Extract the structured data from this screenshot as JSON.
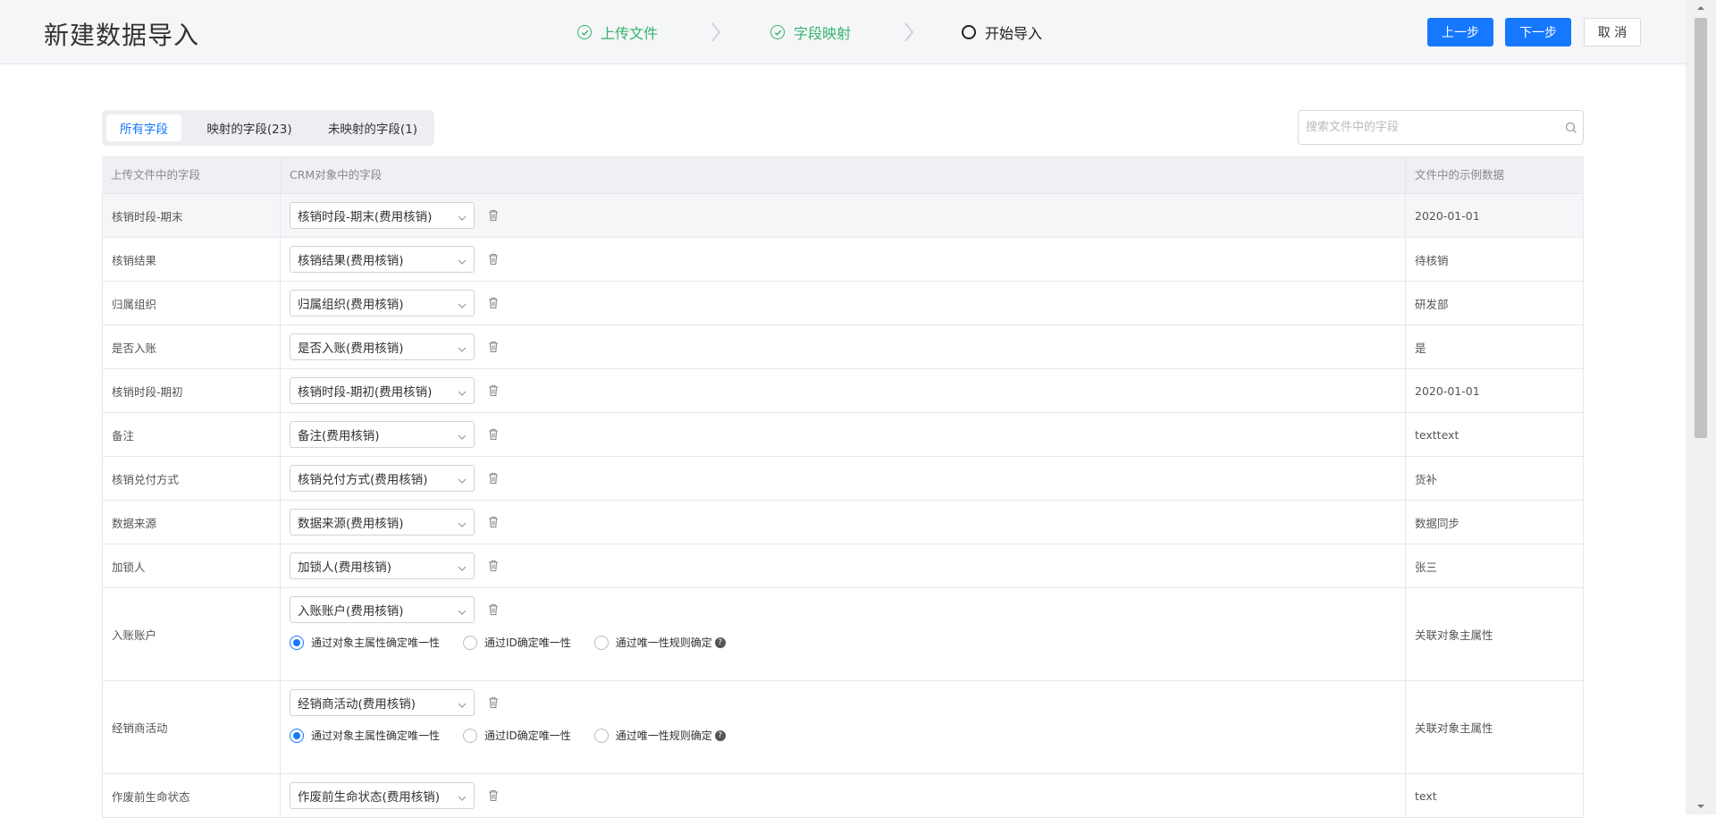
{
  "header": {
    "title": "新建数据导入",
    "steps": [
      {
        "label": "上传文件",
        "status": "done"
      },
      {
        "label": "字段映射",
        "status": "done"
      },
      {
        "label": "开始导入",
        "status": "current"
      }
    ],
    "prev_label": "上一步",
    "next_label": "下一步",
    "cancel_label": "取 消"
  },
  "tabs": [
    {
      "label": "所有字段",
      "active": true
    },
    {
      "label": "映射的字段(23)",
      "active": false
    },
    {
      "label": "未映射的字段(1)",
      "active": false
    }
  ],
  "search": {
    "placeholder": "搜索文件中的字段",
    "value": ""
  },
  "table": {
    "columns": [
      "上传文件中的字段",
      "CRM对象中的字段",
      "文件中的示例数据"
    ],
    "radio_options": [
      "通过对象主属性确定唯一性",
      "通过ID确定唯一性",
      "通过唯一性规则确定"
    ],
    "rows": [
      {
        "file_field": "核销时段-期末",
        "crm_field": "核销时段-期末(费用核销)",
        "sample": "2020-01-01"
      },
      {
        "file_field": "核销结果",
        "crm_field": "核销结果(费用核销)",
        "sample": "待核销"
      },
      {
        "file_field": "归属组织",
        "crm_field": "归属组织(费用核销)",
        "sample": "研发部"
      },
      {
        "file_field": "是否入账",
        "crm_field": "是否入账(费用核销)",
        "sample": "是"
      },
      {
        "file_field": "核销时段-期初",
        "crm_field": "核销时段-期初(费用核销)",
        "sample": "2020-01-01"
      },
      {
        "file_field": "备注",
        "crm_field": "备注(费用核销)",
        "sample": "texttext"
      },
      {
        "file_field": "核销兑付方式",
        "crm_field": "核销兑付方式(费用核销)",
        "sample": "货补"
      },
      {
        "file_field": "数据来源",
        "crm_field": "数据来源(费用核销)",
        "sample": "数据同步"
      },
      {
        "file_field": "加锁人",
        "crm_field": "加锁人(费用核销)",
        "sample": "张三"
      },
      {
        "file_field": "入账账户",
        "crm_field": "入账账户(费用核销)",
        "sample": "关联对象主属性",
        "has_radios": true,
        "selected_radio": 0
      },
      {
        "file_field": "经销商活动",
        "crm_field": "经销商活动(费用核销)",
        "sample": "关联对象主属性",
        "has_radios": true,
        "selected_radio": 0
      },
      {
        "file_field": "作废前生命状态",
        "crm_field": "作废前生命状态(费用核销)",
        "sample": "text"
      }
    ]
  },
  "colors": {
    "primary": "#1677ff",
    "success": "#36b46a",
    "header_bg": "#f5f6f8"
  }
}
